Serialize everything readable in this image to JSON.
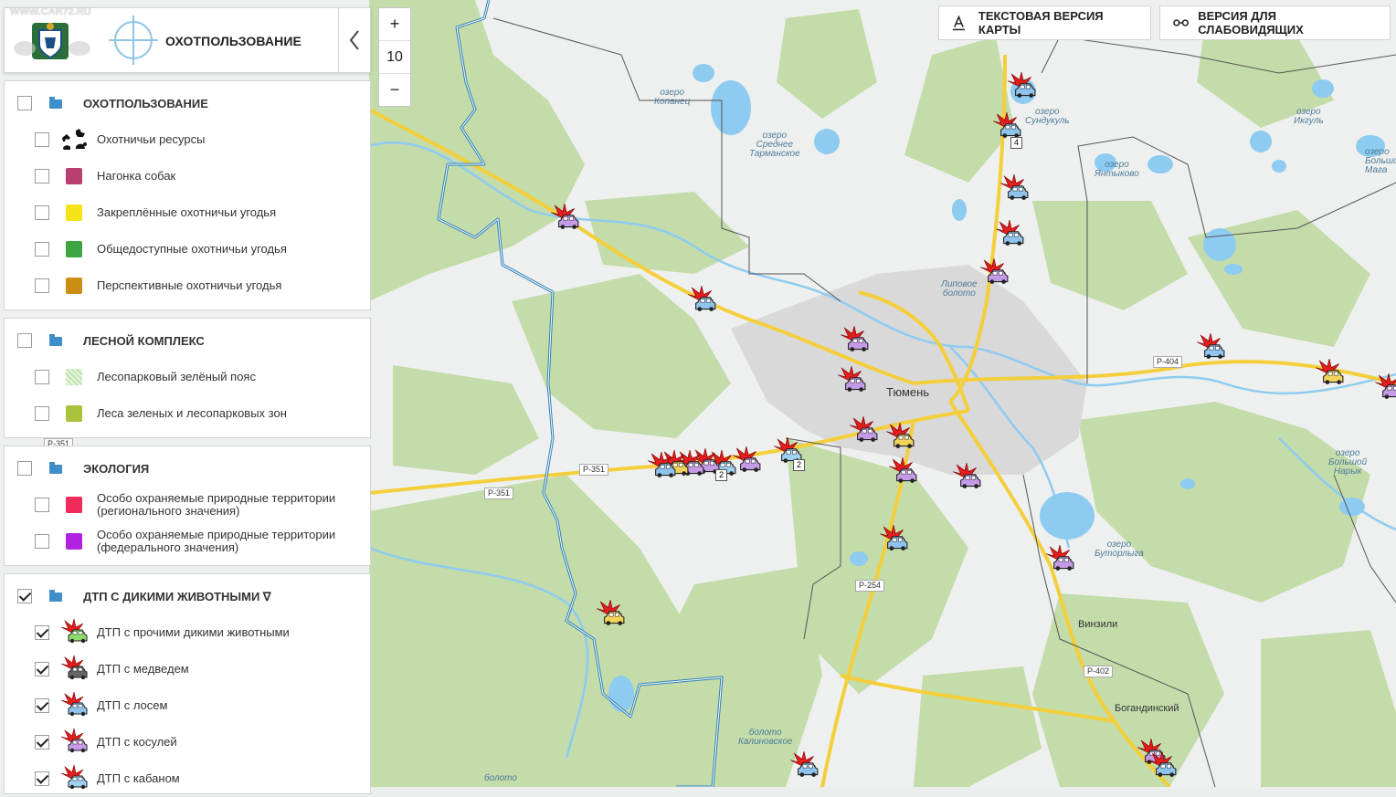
{
  "watermark": "WWW.CAR72.RU",
  "header": {
    "title": "ОХОТПОЛЬЗОВАНИЕ"
  },
  "zoom": {
    "plus": "+",
    "level": "10",
    "minus": "−"
  },
  "top_buttons": {
    "text_version": "ТЕКСТОВАЯ ВЕРСИЯ КАРТЫ",
    "low_vision": "ВЕРСИЯ ДЛЯ СЛАБОВИДЯЩИХ"
  },
  "groups": [
    {
      "title": "ОХОТПОЛЬЗОВАНИЕ",
      "checked": false,
      "items": [
        {
          "label": "Охотничьи ресурсы",
          "checked": false,
          "icon": "animals-icon"
        },
        {
          "label": "Нагонка собак",
          "checked": false,
          "color": "#b83f6e"
        },
        {
          "label": "Закреплённые охотничьи угодья",
          "checked": false,
          "color": "#f5e31a"
        },
        {
          "label": "Общедоступные охотничьи угодья",
          "checked": false,
          "color": "#3da541"
        },
        {
          "label": "Перспективные охотничьи угодья",
          "checked": false,
          "color": "#c98e12"
        }
      ]
    },
    {
      "title": "ЛЕСНОЙ КОМПЛЕКС",
      "checked": false,
      "items": [
        {
          "label": "Лесопарковый зелёный пояс",
          "checked": false,
          "color": "#bfe3b0"
        },
        {
          "label": "Леса зеленых и лесопарковых зон",
          "checked": false,
          "color": "#a8c23a"
        }
      ]
    },
    {
      "title": "ЭКОЛОГИЯ",
      "checked": false,
      "items": [
        {
          "label": "Особо охраняемые природные территории",
          "label2": "(регионального значения)",
          "checked": false,
          "color": "#f02a5a"
        },
        {
          "label": "Особо охраняемые природные территории",
          "label2": "(федерального значения)",
          "checked": false,
          "color": "#b122e0"
        }
      ]
    },
    {
      "title": "ДТП С ДИКИМИ ЖИВОТНЫМИ ∇",
      "checked": true,
      "items": [
        {
          "label": "ДТП с прочими дикими животными",
          "checked": true,
          "car": "#8ddc6a"
        },
        {
          "label": "ДТП с медведем",
          "checked": true,
          "car": "#666666"
        },
        {
          "label": "ДТП с лосем",
          "checked": true,
          "car": "#8fc4ee"
        },
        {
          "label": "ДТП с косулей",
          "checked": true,
          "car": "#c59be8"
        },
        {
          "label": "ДТП с кабаном",
          "checked": true,
          "car": "#9fd3f1"
        }
      ]
    }
  ],
  "map": {
    "city": "Тюмень",
    "places": [
      {
        "text": "озеро\nКопанец"
      },
      {
        "text": "озеро\nСреднее\nТарманское"
      },
      {
        "text": "озеро\nСундукуль"
      },
      {
        "text": "озеро\nЯнтыково"
      },
      {
        "text": "озеро\nИкгуль"
      },
      {
        "text": "Липовое\nболото"
      },
      {
        "text": "озеро\nБольшой\nНарык"
      },
      {
        "text": "озеро\nБуторлыга"
      },
      {
        "text": "болото\nКалиновское"
      },
      {
        "text": "болото"
      },
      {
        "text": "озеро\nБольшо\nМага"
      }
    ],
    "villages": [
      "Винзили",
      "Богандинский"
    ],
    "roads": [
      "Р-351",
      "Р-351",
      "Р-351",
      "Р-404",
      "Р-254",
      "Р-402"
    ],
    "badges": [
      "4",
      "2",
      "2"
    ]
  },
  "colors": {
    "forest": "#bedaa6",
    "water": "#8ecbf0",
    "urban": "#dcdcdc",
    "road": "#f7d44a",
    "border": "#2d7fb5"
  }
}
